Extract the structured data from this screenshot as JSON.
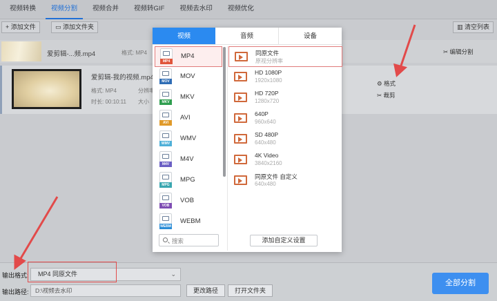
{
  "tabs": [
    {
      "label": "视频转换",
      "active": false
    },
    {
      "label": "视频分割",
      "active": true
    },
    {
      "label": "视频合并",
      "active": false
    },
    {
      "label": "视频转GIF",
      "active": false
    },
    {
      "label": "视频去水印",
      "active": false
    },
    {
      "label": "视频优化",
      "active": false
    }
  ],
  "toolbar": {
    "add_file": "添加文件",
    "add_folder": "添加文件夹",
    "clear_list": "清空列表"
  },
  "file1": {
    "name": "爱剪辑-...频.mp4",
    "format_label": "格式: MP4",
    "edit_split": "编辑分割"
  },
  "file2": {
    "name": "爱剪辑-我的视频.mp4",
    "format_label": "格式: MP4",
    "duration_label": "时长: 00:10:11",
    "resolution_label": "分辨率",
    "size_label": "大小",
    "format_action": "格式",
    "cut_action": "裁剪"
  },
  "popup": {
    "tabs": {
      "video": "视频",
      "audio": "音频",
      "device": "设备"
    },
    "formats": [
      {
        "name": "MP4",
        "color": "#e0553b",
        "selected": true
      },
      {
        "name": "MOV",
        "color": "#2f6db5"
      },
      {
        "name": "MKV",
        "color": "#2f9e4f"
      },
      {
        "name": "AVI",
        "color": "#e09a2a"
      },
      {
        "name": "WMV",
        "color": "#4fb0d8"
      },
      {
        "name": "M4V",
        "color": "#6b5fc4"
      },
      {
        "name": "MPG",
        "color": "#3aa7b0"
      },
      {
        "name": "VOB",
        "color": "#7f4db3"
      },
      {
        "name": "WEBM",
        "color": "#2a8cd6"
      }
    ],
    "search_placeholder": "搜索",
    "presets": [
      {
        "name": "同原文件",
        "detail": "原视分辨率",
        "selected": true
      },
      {
        "name": "HD 1080P",
        "detail": "1920x1080"
      },
      {
        "name": "HD 720P",
        "detail": "1280x720"
      },
      {
        "name": "640P",
        "detail": "960x640"
      },
      {
        "name": "SD 480P",
        "detail": "640x480"
      },
      {
        "name": "4K Video",
        "detail": "3840x2160"
      },
      {
        "name": "同原文件 自定义",
        "detail": "640x480"
      }
    ],
    "add_custom": "添加自定义设置"
  },
  "bottom": {
    "output_format_label": "输出格式:",
    "output_format_value": "MP4  同原文件",
    "output_path_label": "输出路径:",
    "output_path_value": "D:\\视频去水印",
    "change_path": "更改路径",
    "open_folder": "打开文件夹",
    "split_all": "全部分割"
  },
  "colors": {
    "accent": "#2b8af0",
    "annotation": "#e24a4a",
    "preset_icon": "#d0683a"
  }
}
